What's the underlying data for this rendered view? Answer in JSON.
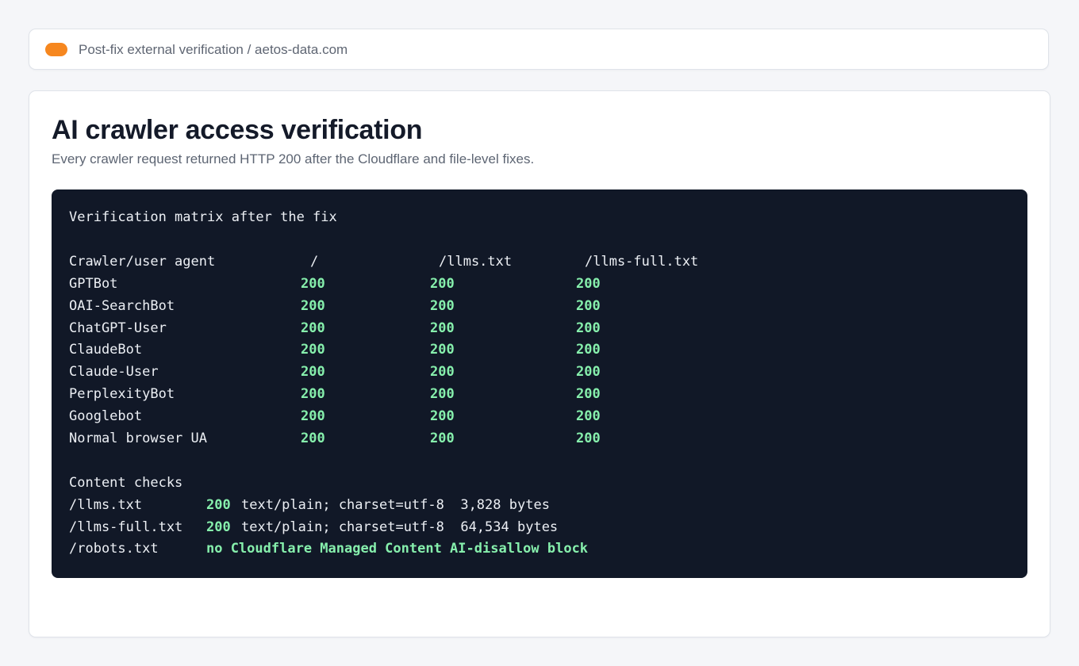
{
  "breadcrumb": {
    "text": "Post-fix external verification / aetos-data.com",
    "status_color": "#f6871f"
  },
  "main": {
    "title": "AI crawler access verification",
    "subtitle": "Every crawler request returned HTTP 200 after the Cloudflare and file-level fixes."
  },
  "terminal": {
    "heading": "Verification matrix after the fix",
    "columns": [
      "Crawler/user agent",
      "/",
      "/llms.txt",
      "/llms-full.txt"
    ],
    "rows": [
      {
        "agent": "GPTBot",
        "root": "200",
        "llms": "200",
        "llms_full": "200"
      },
      {
        "agent": "OAI-SearchBot",
        "root": "200",
        "llms": "200",
        "llms_full": "200"
      },
      {
        "agent": "ChatGPT-User",
        "root": "200",
        "llms": "200",
        "llms_full": "200"
      },
      {
        "agent": "ClaudeBot",
        "root": "200",
        "llms": "200",
        "llms_full": "200"
      },
      {
        "agent": "Claude-User",
        "root": "200",
        "llms": "200",
        "llms_full": "200"
      },
      {
        "agent": "PerplexityBot",
        "root": "200",
        "llms": "200",
        "llms_full": "200"
      },
      {
        "agent": "Googlebot",
        "root": "200",
        "llms": "200",
        "llms_full": "200"
      },
      {
        "agent": "Normal browser UA",
        "root": "200",
        "llms": "200",
        "llms_full": "200"
      }
    ],
    "content_heading": "Content checks",
    "content_checks": [
      {
        "path": "/llms.txt",
        "status": "200",
        "detail": "text/plain; charset=utf-8  3,828 bytes"
      },
      {
        "path": "/llms-full.txt",
        "status": "200",
        "detail": "text/plain; charset=utf-8  64,534 bytes"
      },
      {
        "path": "/robots.txt",
        "status": "no Cloudflare Managed Content AI-disallow block",
        "detail": ""
      }
    ],
    "accent_color": "#86efac",
    "background_color": "#111827"
  }
}
